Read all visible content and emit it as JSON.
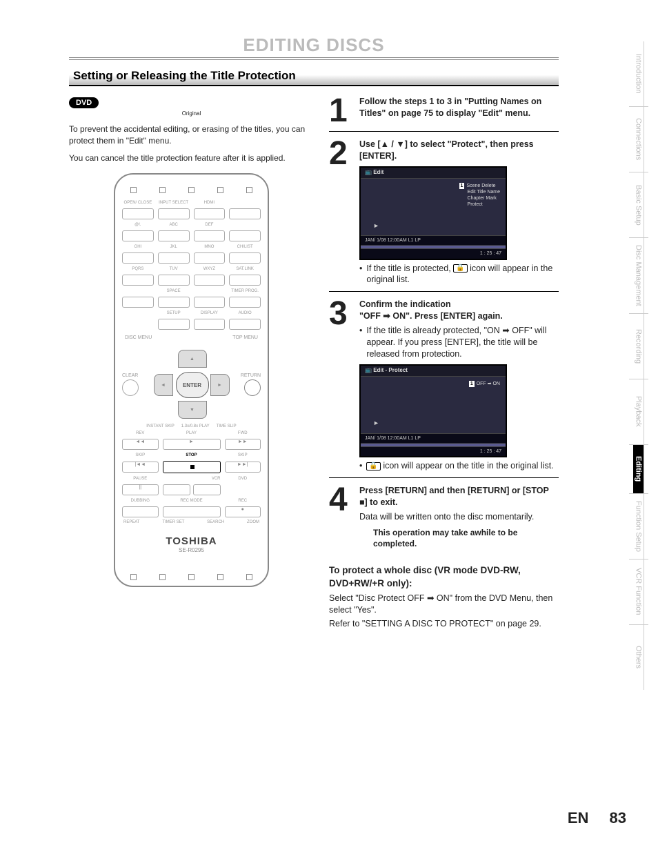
{
  "chapter_title": "EDITING DISCS",
  "section_title": "Setting or Releasing the Title Protection",
  "dvd_badge": "DVD",
  "dvd_badge_sub": "Original",
  "intro_p1": "To prevent the accidental editing, or erasing of the titles, you can protect them in \"Edit\" menu.",
  "intro_p2": "You can cancel the title protection feature after it is applied.",
  "remote": {
    "brand": "TOSHIBA",
    "model": "SE-R0295",
    "labels": {
      "open_close": "OPEN/ CLOSE",
      "input_select": "INPUT SELECT",
      "hdmi": "HDMI",
      "disc_menu": "DISC MENU",
      "top_menu": "TOP MENU",
      "clear": "CLEAR",
      "return": "RETURN",
      "enter": "ENTER",
      "stop": "STOP",
      "play": "PLAY",
      "pause": "PAUSE",
      "skip": "SKIP",
      "rev": "REV",
      "fwd": "FWD",
      "setup": "SETUP",
      "display": "DISPLAY",
      "audio": "AUDIO",
      "space": "SPACE",
      "instant_skip": "INSTANT SKIP",
      "time_slip": "TIME SLIP",
      "rec": "REC",
      "vcr": "VCR",
      "dvd": "DVD",
      "dubbing": "DUBBING",
      "zoom": "ZOOM",
      "repeat": "REPEAT",
      "search": "SEARCH",
      "sat_link": "SAT.LINK"
    }
  },
  "steps": {
    "s1": {
      "num": "1",
      "head": "Follow the steps 1 to 3 in \"Putting Names on Titles\" on page 75 to display \"Edit\" menu."
    },
    "s2": {
      "num": "2",
      "head": "Use [▲ / ▼] to select \"Protect\", then press [ENTER].",
      "screen": {
        "title": "Edit",
        "menu1": "Scene Delete",
        "menu2": "Edit Title Name",
        "menu3": "Chapter Mark",
        "menu4": "Protect",
        "status_left": "JAN/ 1/08 12:00AM L1   LP",
        "status_right": "1 : 25 : 47"
      },
      "bullet": "If the title is protected, ",
      "bullet_tail": " icon will appear in the original list."
    },
    "s3": {
      "num": "3",
      "head_a": "Confirm the indication",
      "head_b": "\"OFF ➡ ON\". Press [ENTER] again.",
      "bullet1": "If the title is already protected, \"ON ➡ OFF\" will appear. If you press [ENTER], the title will be released from protection.",
      "screen": {
        "title": "Edit - Protect",
        "toggle": "OFF ➡ ON",
        "status_left": "JAN/ 1/08 12:00AM L1   LP",
        "status_right": "1 : 25 : 47"
      },
      "bullet2_tail": " icon will appear on the title in the original list."
    },
    "s4": {
      "num": "4",
      "head": "Press [RETURN] and then [RETURN] or [STOP ■] to exit.",
      "body": "Data will be written onto the disc momentarily.",
      "note": "This operation may take awhile to be completed."
    }
  },
  "whole_disc": {
    "head": "To protect a whole disc (VR mode DVD-RW, DVD+RW/+R only):",
    "p1": "Select \"Disc Protect OFF ➡ ON\" from the DVD Menu, then select \"Yes\".",
    "p2": "Refer to \"SETTING A DISC TO PROTECT\" on page 29."
  },
  "tabs": [
    "Introduction",
    "Connections",
    "Basic Setup",
    "Disc\nManagement",
    "Recording",
    "Playback",
    "Editing",
    "Function Setup",
    "VCR Function",
    "Others"
  ],
  "footer": {
    "lang": "EN",
    "page": "83"
  }
}
